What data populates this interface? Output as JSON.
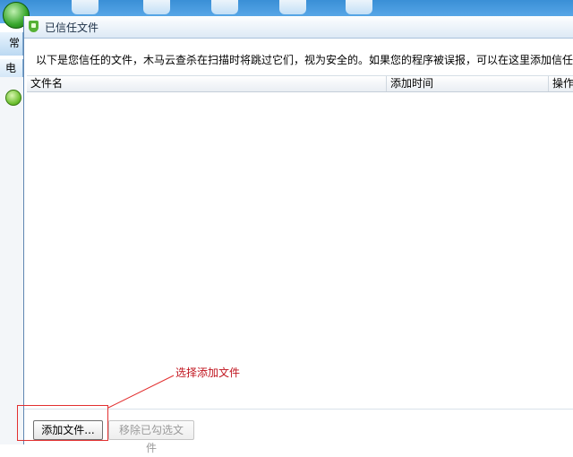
{
  "background": {
    "left_tab_label": "常",
    "left_tab2_label": "电脑"
  },
  "dialog": {
    "title": "已信任文件",
    "description": "以下是您信任的文件，木马云查杀在扫描时将跳过它们，视为安全的。如果您的程序被误报，可以在这里添加信任",
    "columns": {
      "name": "文件名",
      "time": "添加时间",
      "op": "操作"
    },
    "buttons": {
      "add": "添加文件...",
      "remove": "移除已勾选文件"
    }
  },
  "annotation": {
    "text": "选择添加文件",
    "color": "#c0141e"
  },
  "colors": {
    "title_bar": "#dde9f5",
    "accent_green": "#56b135",
    "annotation_red": "#e23030"
  }
}
